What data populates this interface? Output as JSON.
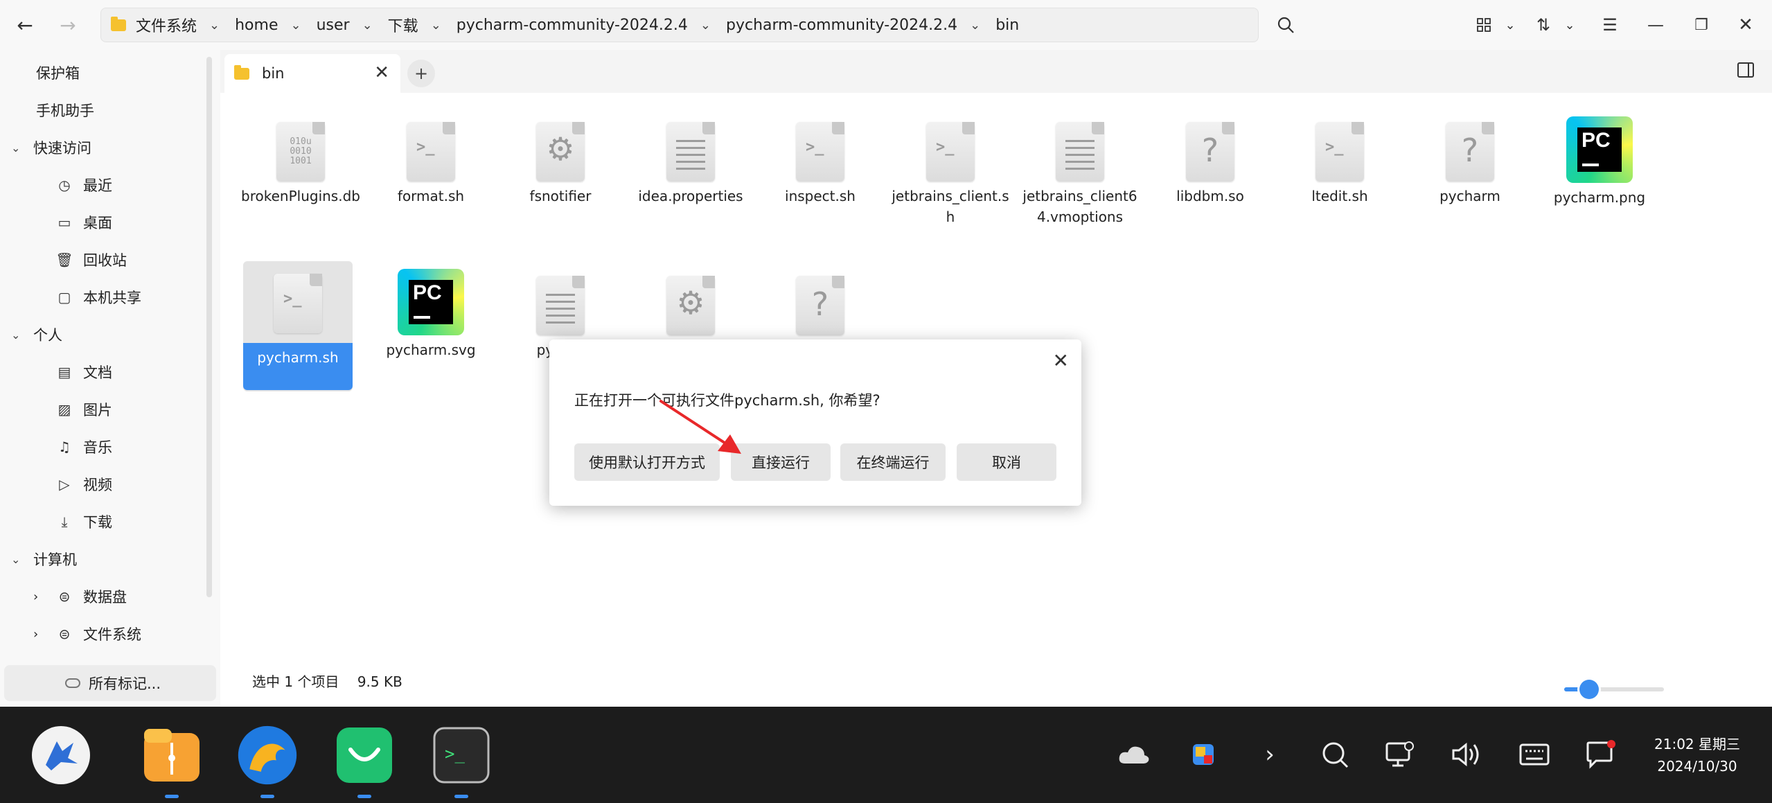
{
  "window": {
    "breadcrumb": [
      "文件系统",
      "home",
      "user",
      "下载",
      "pycharm-community-2024.2.4",
      "pycharm-community-2024.2.4",
      "bin"
    ]
  },
  "sidebar": {
    "items": [
      {
        "label": "保护箱"
      },
      {
        "label": "手机助手"
      }
    ],
    "quick_access": {
      "label": "快速访问",
      "items": [
        "最近",
        "桌面",
        "回收站",
        "本机共享"
      ]
    },
    "personal": {
      "label": "个人",
      "items": [
        "文档",
        "图片",
        "音乐",
        "视频",
        "下载"
      ]
    },
    "computer": {
      "label": "计算机",
      "items": [
        "数据盘",
        "文件系统"
      ]
    },
    "all_tags": "所有标记..."
  },
  "tabs": [
    {
      "label": "bin"
    }
  ],
  "files": [
    {
      "name": "brokenPlugins.db",
      "icon": "binary-file-icon"
    },
    {
      "name": "format.sh",
      "icon": "shell-script-icon"
    },
    {
      "name": "fsnotifier",
      "icon": "executable-gear-icon"
    },
    {
      "name": "idea.properties",
      "icon": "text-file-icon"
    },
    {
      "name": "inspect.sh",
      "icon": "shell-script-icon"
    },
    {
      "name": "jetbrains_client.sh",
      "icon": "shell-script-icon"
    },
    {
      "name": "jetbrains_client64.vmoptions",
      "icon": "text-file-icon"
    },
    {
      "name": "libdbm.so",
      "icon": "unknown-file-icon"
    },
    {
      "name": "ltedit.sh",
      "icon": "shell-script-icon"
    },
    {
      "name": "pycharm",
      "icon": "unknown-file-icon"
    },
    {
      "name": "pycharm.png",
      "icon": "pycharm-logo-icon"
    },
    {
      "name": "pycharm.sh",
      "icon": "shell-script-icon",
      "selected": true
    },
    {
      "name": "pycharm.svg",
      "icon": "pycharm-logo-icon"
    },
    {
      "name": "pychar",
      "name2": "pt",
      "icon": "text-file-icon"
    },
    {
      "name": "",
      "icon": "executable-gear-icon"
    },
    {
      "name": "",
      "icon": "unknown-file-icon"
    }
  ],
  "status": {
    "selection": "选中 1 个项目",
    "size": "9.5 KB",
    "zoom_fraction": 0.25
  },
  "dialog": {
    "message": "正在打开一个可执行文件pycharm.sh, 你希望?",
    "buttons": [
      "使用默认打开方式",
      "直接运行",
      "在终端运行",
      "取消"
    ]
  },
  "taskbar": {
    "time": "21:02 星期三",
    "date": "2024/10/30"
  },
  "colors": {
    "accent": "#3a8df0",
    "folder": "#f5c12e",
    "arrow": "#e8282a"
  }
}
